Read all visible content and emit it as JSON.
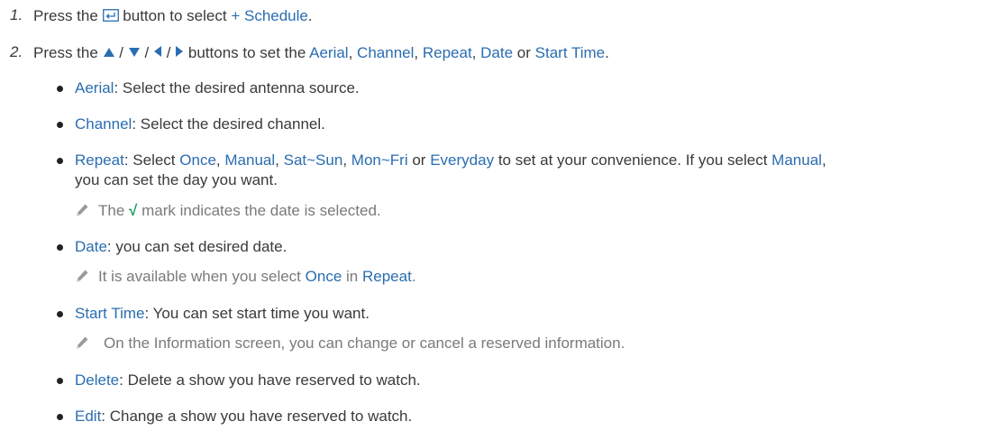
{
  "step1": {
    "num": "1.",
    "pre": "Press the",
    "post": "button to select",
    "target": "+ Schedule",
    "end": "."
  },
  "step2": {
    "num": "2.",
    "pre": "Press the",
    "sep": "/",
    "mid": "buttons to set the",
    "k1": "Aerial",
    "c1": ",",
    "k2": "Channel",
    "c2": ",",
    "k3": "Repeat",
    "c3": ",",
    "k4": "Date",
    "or": "or",
    "k5": "Start Time",
    "end": "."
  },
  "aerial": {
    "term": "Aerial",
    "desc": ": Select the desired antenna source."
  },
  "channel": {
    "term": "Channel",
    "desc": ": Select the desired channel."
  },
  "repeat": {
    "term": "Repeat",
    "t1": ": Select",
    "o1": "Once",
    "s1": ",",
    "o2": "Manual",
    "s2": ",",
    "o3": "Sat~Sun",
    "s3": ",",
    "o4": "Mon~Fri",
    "or": "or",
    "o5": "Everyday",
    "t2": "to set at your convenience. If you select",
    "o6": "Manual",
    "s6": ",",
    "line2": "you can set the day you want."
  },
  "repeat_note": {
    "pre": "The",
    "mark": "√",
    "post": "mark indicates the date is selected."
  },
  "date": {
    "term": "Date",
    "desc": ": you can set desired date."
  },
  "date_note": {
    "pre": "It is available when you select",
    "k1": "Once",
    "in": "in",
    "k2": "Repeat",
    "end": "."
  },
  "start": {
    "term": "Start Time",
    "desc": ": You can set start time you want."
  },
  "start_note": {
    "text": "On the Information screen, you can change or cancel a reserved information."
  },
  "delete": {
    "term": "Delete",
    "desc": ": Delete a show you have reserved to watch."
  },
  "edit": {
    "term": "Edit",
    "desc": ": Change a show you have reserved to watch."
  },
  "colors": {
    "keyword": "#2a6db0",
    "body": "#3a3a3a",
    "note": "#7a7a7a",
    "check": "#1aa05a"
  },
  "icons": [
    "enter-button-icon",
    "up-arrow-icon",
    "down-arrow-icon",
    "left-arrow-icon",
    "right-arrow-icon",
    "pencil-note-icon"
  ]
}
